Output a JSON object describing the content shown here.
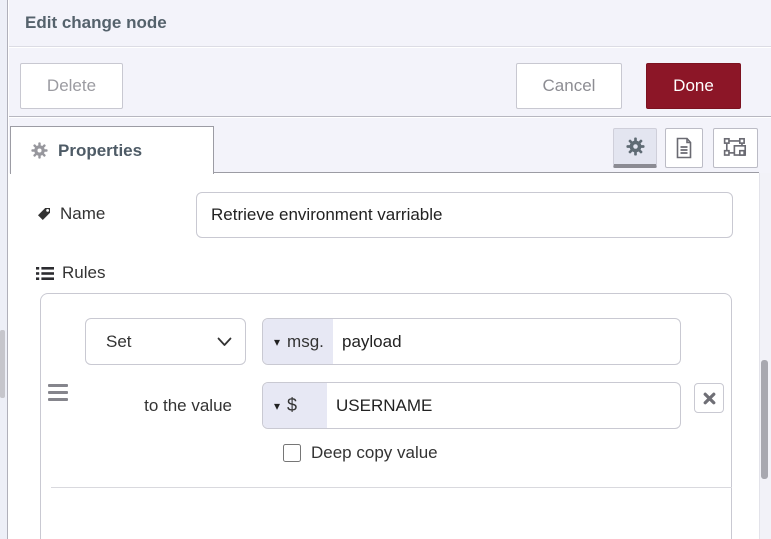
{
  "dialog": {
    "title": "Edit change node"
  },
  "buttons": {
    "delete": "Delete",
    "cancel": "Cancel",
    "done": "Done"
  },
  "tab_bar": {
    "properties_label": "Properties",
    "icon_buttons": [
      "gear-icon",
      "description-doc-icon",
      "appearance-icon"
    ]
  },
  "form": {
    "name_label": "Name",
    "name_value": "Retrieve environment varriable",
    "rules_label": "Rules",
    "rule": {
      "action": "Set",
      "property_prefix": "msg.",
      "property_value": "payload",
      "to_label": "to the value",
      "value_prefix": "$",
      "value_value": "USERNAME",
      "deep_copy_label": "Deep copy value",
      "deep_copy_checked": false
    }
  },
  "icons": {
    "caret_down": "▾",
    "names": [
      "gear-icon",
      "description-doc-icon",
      "appearance-icon",
      "tag-icon",
      "list-icon",
      "chevron-down-icon",
      "caret-down-icon",
      "drag-handle-icon",
      "close-icon"
    ]
  },
  "colors": {
    "accent_red": "#8C1627",
    "panel_bg": "#f3f3fa",
    "prefix_bg": "#e7e8f4",
    "tab_border": "#9c9ca4",
    "input_border": "#c9c9d2"
  }
}
